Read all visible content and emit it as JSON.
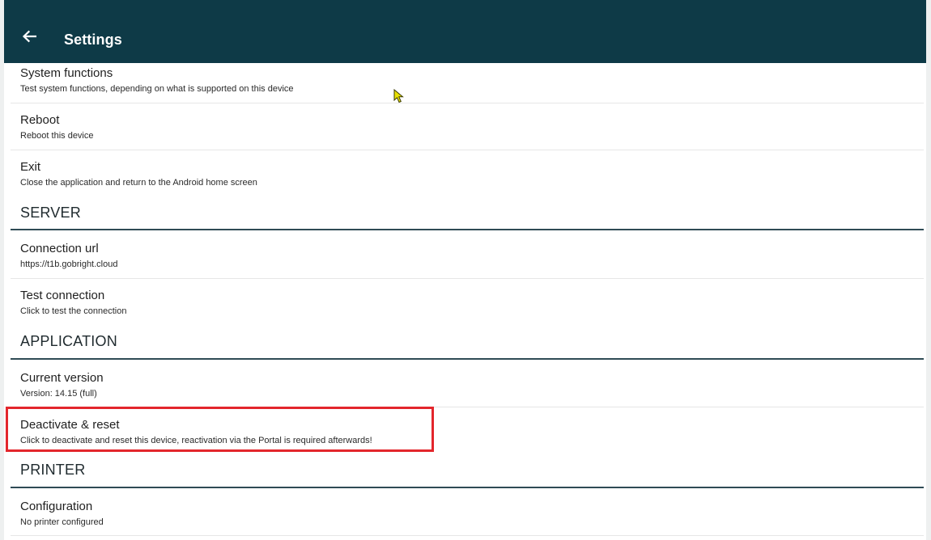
{
  "app_bar": {
    "title": "Settings",
    "back_icon": "arrow-left-icon",
    "background": "#0e3a47"
  },
  "items_top": [
    {
      "title": "System functions",
      "subtitle": "Test system functions, depending on what is supported on this device"
    },
    {
      "title": "Reboot",
      "subtitle": "Reboot this device"
    },
    {
      "title": "Exit",
      "subtitle": "Close the application and return to the Android home screen"
    }
  ],
  "sections": {
    "server": {
      "header": "SERVER",
      "items": [
        {
          "title": "Connection url",
          "subtitle": "https://t1b.gobright.cloud"
        },
        {
          "title": "Test connection",
          "subtitle": "Click to test the connection"
        }
      ]
    },
    "application": {
      "header": "APPLICATION",
      "items": [
        {
          "title": "Current version",
          "subtitle": "Version: 14.15 (full)"
        },
        {
          "title": "Deactivate & reset",
          "subtitle": "Click to deactivate and reset this device, reactivation via the Portal is required afterwards!"
        }
      ]
    },
    "printer": {
      "header": "PRINTER",
      "items": [
        {
          "title": "Configuration",
          "subtitle": "No printer configured"
        }
      ]
    }
  },
  "colors": {
    "highlight_border": "#e3262c",
    "section_line": "#2f4b55",
    "cursor": "#e8e000"
  }
}
